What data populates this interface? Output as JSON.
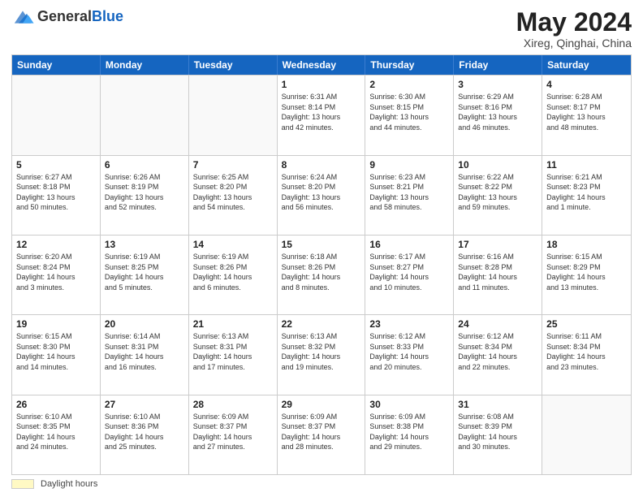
{
  "header": {
    "logo_general": "General",
    "logo_blue": "Blue",
    "title": "May 2024",
    "location": "Xireg, Qinghai, China"
  },
  "weekdays": [
    "Sunday",
    "Monday",
    "Tuesday",
    "Wednesday",
    "Thursday",
    "Friday",
    "Saturday"
  ],
  "rows": [
    [
      {
        "day": "",
        "info": ""
      },
      {
        "day": "",
        "info": ""
      },
      {
        "day": "",
        "info": ""
      },
      {
        "day": "1",
        "info": "Sunrise: 6:31 AM\nSunset: 8:14 PM\nDaylight: 13 hours\nand 42 minutes."
      },
      {
        "day": "2",
        "info": "Sunrise: 6:30 AM\nSunset: 8:15 PM\nDaylight: 13 hours\nand 44 minutes."
      },
      {
        "day": "3",
        "info": "Sunrise: 6:29 AM\nSunset: 8:16 PM\nDaylight: 13 hours\nand 46 minutes."
      },
      {
        "day": "4",
        "info": "Sunrise: 6:28 AM\nSunset: 8:17 PM\nDaylight: 13 hours\nand 48 minutes."
      }
    ],
    [
      {
        "day": "5",
        "info": "Sunrise: 6:27 AM\nSunset: 8:18 PM\nDaylight: 13 hours\nand 50 minutes."
      },
      {
        "day": "6",
        "info": "Sunrise: 6:26 AM\nSunset: 8:19 PM\nDaylight: 13 hours\nand 52 minutes."
      },
      {
        "day": "7",
        "info": "Sunrise: 6:25 AM\nSunset: 8:20 PM\nDaylight: 13 hours\nand 54 minutes."
      },
      {
        "day": "8",
        "info": "Sunrise: 6:24 AM\nSunset: 8:20 PM\nDaylight: 13 hours\nand 56 minutes."
      },
      {
        "day": "9",
        "info": "Sunrise: 6:23 AM\nSunset: 8:21 PM\nDaylight: 13 hours\nand 58 minutes."
      },
      {
        "day": "10",
        "info": "Sunrise: 6:22 AM\nSunset: 8:22 PM\nDaylight: 13 hours\nand 59 minutes."
      },
      {
        "day": "11",
        "info": "Sunrise: 6:21 AM\nSunset: 8:23 PM\nDaylight: 14 hours\nand 1 minute."
      }
    ],
    [
      {
        "day": "12",
        "info": "Sunrise: 6:20 AM\nSunset: 8:24 PM\nDaylight: 14 hours\nand 3 minutes."
      },
      {
        "day": "13",
        "info": "Sunrise: 6:19 AM\nSunset: 8:25 PM\nDaylight: 14 hours\nand 5 minutes."
      },
      {
        "day": "14",
        "info": "Sunrise: 6:19 AM\nSunset: 8:26 PM\nDaylight: 14 hours\nand 6 minutes."
      },
      {
        "day": "15",
        "info": "Sunrise: 6:18 AM\nSunset: 8:26 PM\nDaylight: 14 hours\nand 8 minutes."
      },
      {
        "day": "16",
        "info": "Sunrise: 6:17 AM\nSunset: 8:27 PM\nDaylight: 14 hours\nand 10 minutes."
      },
      {
        "day": "17",
        "info": "Sunrise: 6:16 AM\nSunset: 8:28 PM\nDaylight: 14 hours\nand 11 minutes."
      },
      {
        "day": "18",
        "info": "Sunrise: 6:15 AM\nSunset: 8:29 PM\nDaylight: 14 hours\nand 13 minutes."
      }
    ],
    [
      {
        "day": "19",
        "info": "Sunrise: 6:15 AM\nSunset: 8:30 PM\nDaylight: 14 hours\nand 14 minutes."
      },
      {
        "day": "20",
        "info": "Sunrise: 6:14 AM\nSunset: 8:31 PM\nDaylight: 14 hours\nand 16 minutes."
      },
      {
        "day": "21",
        "info": "Sunrise: 6:13 AM\nSunset: 8:31 PM\nDaylight: 14 hours\nand 17 minutes."
      },
      {
        "day": "22",
        "info": "Sunrise: 6:13 AM\nSunset: 8:32 PM\nDaylight: 14 hours\nand 19 minutes."
      },
      {
        "day": "23",
        "info": "Sunrise: 6:12 AM\nSunset: 8:33 PM\nDaylight: 14 hours\nand 20 minutes."
      },
      {
        "day": "24",
        "info": "Sunrise: 6:12 AM\nSunset: 8:34 PM\nDaylight: 14 hours\nand 22 minutes."
      },
      {
        "day": "25",
        "info": "Sunrise: 6:11 AM\nSunset: 8:34 PM\nDaylight: 14 hours\nand 23 minutes."
      }
    ],
    [
      {
        "day": "26",
        "info": "Sunrise: 6:10 AM\nSunset: 8:35 PM\nDaylight: 14 hours\nand 24 minutes."
      },
      {
        "day": "27",
        "info": "Sunrise: 6:10 AM\nSunset: 8:36 PM\nDaylight: 14 hours\nand 25 minutes."
      },
      {
        "day": "28",
        "info": "Sunrise: 6:09 AM\nSunset: 8:37 PM\nDaylight: 14 hours\nand 27 minutes."
      },
      {
        "day": "29",
        "info": "Sunrise: 6:09 AM\nSunset: 8:37 PM\nDaylight: 14 hours\nand 28 minutes."
      },
      {
        "day": "30",
        "info": "Sunrise: 6:09 AM\nSunset: 8:38 PM\nDaylight: 14 hours\nand 29 minutes."
      },
      {
        "day": "31",
        "info": "Sunrise: 6:08 AM\nSunset: 8:39 PM\nDaylight: 14 hours\nand 30 minutes."
      },
      {
        "day": "",
        "info": ""
      }
    ]
  ],
  "footer": {
    "swatch_label": "Daylight hours"
  }
}
